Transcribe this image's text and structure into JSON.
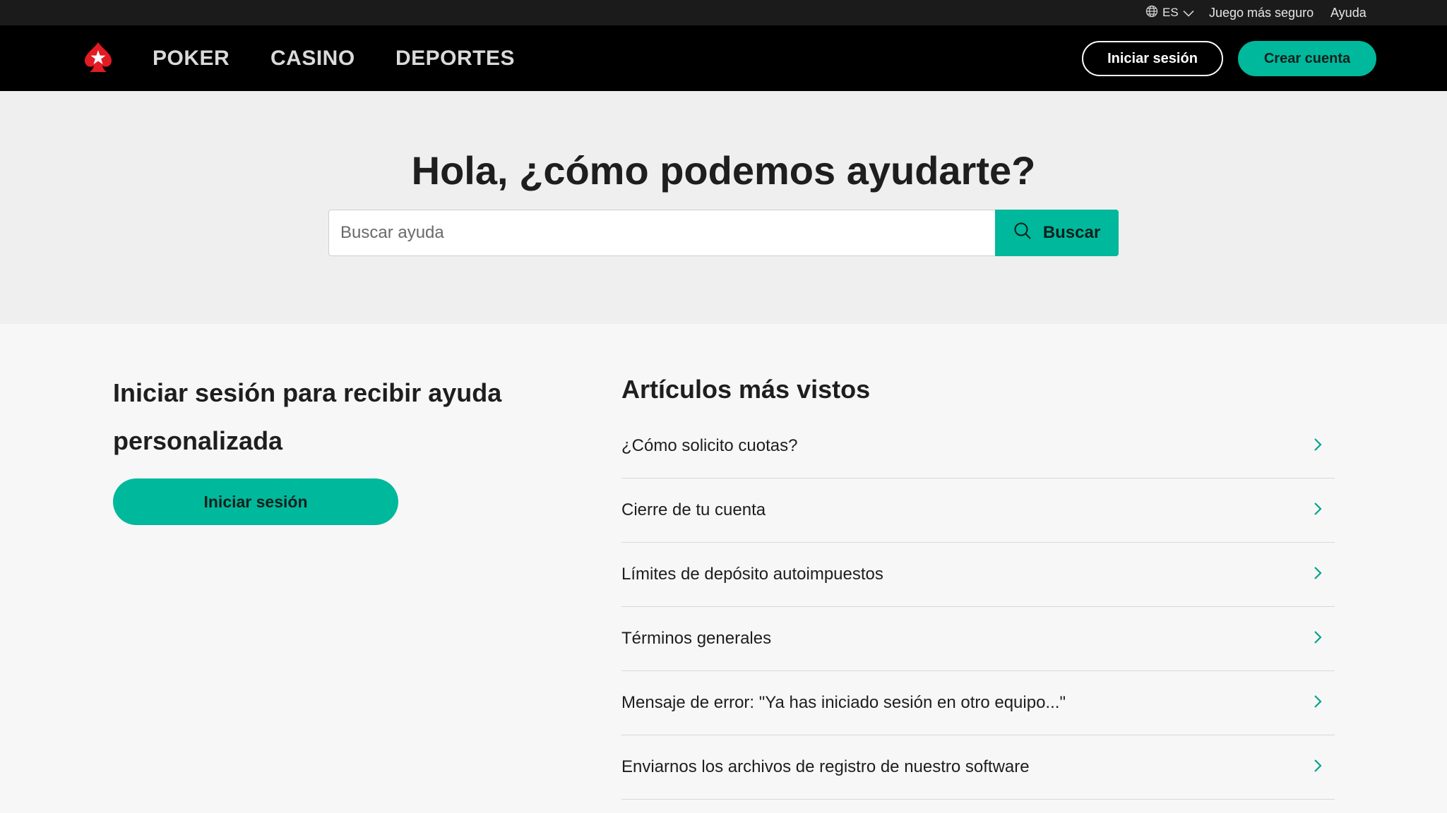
{
  "utility_bar": {
    "language_code": "ES",
    "safer_gambling_label": "Juego más seguro",
    "help_label": "Ayuda"
  },
  "main_nav": {
    "items": [
      {
        "label": "POKER"
      },
      {
        "label": "CASINO"
      },
      {
        "label": "DEPORTES"
      }
    ],
    "login_label": "Iniciar sesión",
    "signup_label": "Crear cuenta"
  },
  "hero": {
    "title": "Hola, ¿cómo podemos ayudarte?",
    "search_placeholder": "Buscar ayuda",
    "search_button_label": "Buscar"
  },
  "login_panel": {
    "title": "Iniciar sesión para recibir ayuda personalizada",
    "button_label": "Iniciar sesión"
  },
  "popular_articles": {
    "title": "Artículos más vistos",
    "items": [
      {
        "label": "¿Cómo solicito cuotas?"
      },
      {
        "label": "Cierre de tu cuenta"
      },
      {
        "label": "Límites de depósito autoimpuestos"
      },
      {
        "label": "Términos generales"
      },
      {
        "label": "Mensaje de error: \"Ya has iniciado sesión en otro equipo...\""
      },
      {
        "label": "Enviarnos los archivos de registro de nuestro software"
      }
    ]
  },
  "colors": {
    "accent": "#00b89c",
    "logo_red": "#e31b23",
    "nav_bg": "#000000",
    "utility_bg": "#1b1b1b"
  },
  "icons": [
    "globe-icon",
    "chevron-down-icon",
    "spade-star-logo",
    "search-icon",
    "chevron-right-icon"
  ]
}
